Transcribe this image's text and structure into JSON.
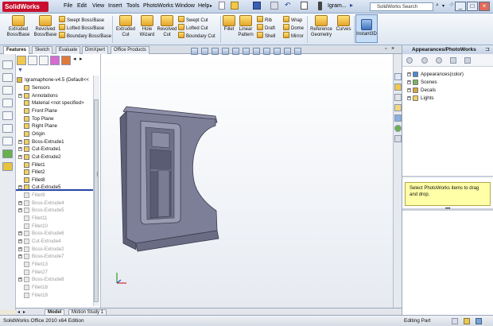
{
  "app": {
    "logo": "SolidWorks",
    "document_short": "Igram...",
    "menus": [
      "File",
      "Edit",
      "View",
      "Insert",
      "Tools",
      "PhotoWorks",
      "Window",
      "Help"
    ],
    "search_placeholder": "SolidWorks Search",
    "window_buttons": [
      "_",
      "□",
      "×"
    ]
  },
  "command_manager": {
    "big_buttons": [
      {
        "label1": "Extruded",
        "label2": "Boss/Base"
      },
      {
        "label1": "Revolved",
        "label2": "Boss/Base"
      },
      {
        "label1": "Extruded",
        "label2": "Cut"
      },
      {
        "label1": "Hole",
        "label2": "Wizard"
      },
      {
        "label1": "Revolved",
        "label2": "Cut"
      },
      {
        "label1": "Fillet",
        "label2": ""
      },
      {
        "label1": "Linear",
        "label2": "Pattern"
      },
      {
        "label1": "Reference",
        "label2": "Geometry"
      },
      {
        "label1": "Curves",
        "label2": ""
      },
      {
        "label1": "Instant3D",
        "label2": ""
      }
    ],
    "small_col1": [
      "Swept Boss/Base",
      "Lofted Boss/Base",
      "Boundary Boss/Base"
    ],
    "small_col2": [
      "Swept Cut",
      "Lofted Cut",
      "Boundary Cut"
    ],
    "small_col3": [
      "Rib",
      "Draft",
      "Shell"
    ],
    "small_col4": [
      "Wrap",
      "Dome",
      "Mirror"
    ]
  },
  "tabs": [
    "Features",
    "Sketch",
    "Evaluate",
    "DimXpert",
    "Office Products"
  ],
  "active_tab": "Features",
  "tree": {
    "root": "Igramaphone-v4.5  (Default<<",
    "items": [
      {
        "label": "Sensors",
        "expander": "",
        "dim": false
      },
      {
        "label": "Annotations",
        "expander": "+",
        "dim": false
      },
      {
        "label": "Material <not specified>",
        "expander": "",
        "dim": false
      },
      {
        "label": "Front Plane",
        "expander": "",
        "dim": false
      },
      {
        "label": "Top Plane",
        "expander": "",
        "dim": false
      },
      {
        "label": "Right Plane",
        "expander": "",
        "dim": false
      },
      {
        "label": "Origin",
        "expander": "",
        "dim": false
      },
      {
        "label": "Boss-Extrude1",
        "expander": "+",
        "dim": false
      },
      {
        "label": "Cut-Extrude1",
        "expander": "+",
        "dim": false
      },
      {
        "label": "Cut-Extrude2",
        "expander": "+",
        "dim": false
      },
      {
        "label": "Fillet1",
        "expander": "",
        "dim": false
      },
      {
        "label": "Fillet2",
        "expander": "",
        "dim": false
      },
      {
        "label": "Fillet8",
        "expander": "",
        "dim": false
      },
      {
        "label": "Cut-Extrude5",
        "expander": "+",
        "dim": false
      },
      {
        "label": "Fillet9",
        "expander": "",
        "dim": true
      },
      {
        "label": "Boss-Extrude4",
        "expander": "+",
        "dim": true
      },
      {
        "label": "Boss-Extrude5",
        "expander": "+",
        "dim": true
      },
      {
        "label": "Fillet11",
        "expander": "",
        "dim": true
      },
      {
        "label": "Fillet10",
        "expander": "",
        "dim": true
      },
      {
        "label": "Boss-Extrude6",
        "expander": "+",
        "dim": true
      },
      {
        "label": "Cut-Extrude4",
        "expander": "+",
        "dim": true
      },
      {
        "label": "Boss-Extrude2",
        "expander": "+",
        "dim": true
      },
      {
        "label": "Boss-Extrude7",
        "expander": "+",
        "dim": true
      },
      {
        "label": "Fillet13",
        "expander": "",
        "dim": true
      },
      {
        "label": "Fillet27",
        "expander": "",
        "dim": true
      },
      {
        "label": "Boss-Extrude8",
        "expander": "+",
        "dim": true
      },
      {
        "label": "Fillet18",
        "expander": "",
        "dim": true
      },
      {
        "label": "Fillet19",
        "expander": "",
        "dim": true
      }
    ]
  },
  "bottom_tabs": [
    "Model",
    "Motion Study 1"
  ],
  "active_bottom_tab": "Model",
  "right_panel": {
    "title": "Appearances/PhotoWorks",
    "items": [
      {
        "label": "Appearances(color)",
        "color": "#4a8ad6"
      },
      {
        "label": "Scenes",
        "color": "#7bb661"
      },
      {
        "label": "Decals",
        "color": "#d8a43a"
      },
      {
        "label": "Lights",
        "color": "#f2d15c"
      }
    ],
    "hint": "Select PhotoWorks items to drag and drop."
  },
  "status": {
    "left": "SolidWorks Office 2010 x64 Edition",
    "right": "Editing Part"
  },
  "colors": {
    "model_face": "#7d7f98",
    "model_dark": "#5e6078",
    "model_light": "#9a9cb3",
    "hint_bg": "#ffffa8"
  }
}
